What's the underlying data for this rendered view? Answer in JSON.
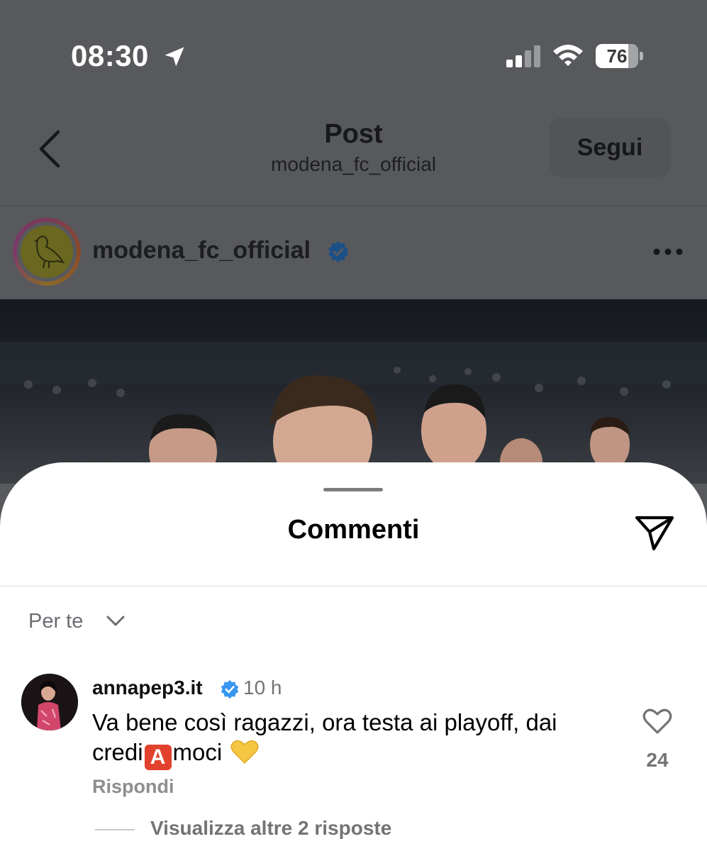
{
  "status_bar": {
    "time": "08:30",
    "battery_level": "76",
    "battery_fraction": 0.76
  },
  "header": {
    "title": "Post",
    "subtitle": "modena_fc_official",
    "follow_label": "Segui"
  },
  "post": {
    "author": "modena_fc_official"
  },
  "comments_sheet": {
    "title": "Commenti",
    "sort_label": "Per te",
    "comments": [
      {
        "username": "annapep3.it",
        "time": "10 h",
        "text_before": "Va bene così ragazzi, ora testa ai playoff, dai credi",
        "badge": "A",
        "text_after": "moci",
        "likes": "24",
        "reply_label": "Rispondi",
        "view_replies_label": "Visualizza altre 2 risposte"
      }
    ]
  },
  "colors": {
    "overlay_background": "#58595c",
    "verified_blue": "#3897f0",
    "badge_red": "#e2412e"
  },
  "icons": {
    "status": [
      "location-arrow-icon",
      "signal-icon",
      "wifi-icon",
      "battery-icon"
    ],
    "header": [
      "back-icon"
    ],
    "post": [
      "verified-icon",
      "more-icon"
    ],
    "sheet": [
      "share-icon",
      "chevron-down-icon",
      "heart-icon",
      "yellow-heart-emoji"
    ]
  }
}
